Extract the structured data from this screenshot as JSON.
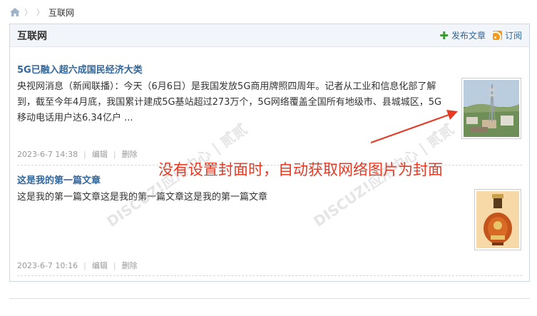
{
  "breadcrumb": {
    "home_icon": "home-icon",
    "current": "互联网"
  },
  "panel": {
    "title": "互联网",
    "publish_label": "发布文章",
    "subscribe_label": "订阅"
  },
  "articles": [
    {
      "title": "5G已融入超六成国民经济大类",
      "summary": "央视网消息（新闻联播）：今天（6月6日）是我国发放5G商用牌照四周年。记者从工业和信息化部了解到，截至今年4月底，我国累计建成5G基站超过273万个，5G网络覆盖全国所有地级市、县城城区，5G移动电话用户达6.34亿户 ...",
      "date": "2023-6-7 14:38",
      "edit_label": "编辑",
      "delete_label": "删除"
    },
    {
      "title": "这是我的第一篇文章",
      "summary": "这是我的第一篇文章这是我的第一篇文章这是我的第一篇文章",
      "date": "2023-6-7 10:16",
      "edit_label": "编辑",
      "delete_label": "删除"
    }
  ],
  "annotation": "没有设置封面时，自动获取网络图片为封面",
  "watermark": "DISCUZ!应用中心 | 贰贰",
  "colors": {
    "accent": "#336699",
    "annotation": "#e53a24",
    "header_bg": "#f2f5f9"
  }
}
